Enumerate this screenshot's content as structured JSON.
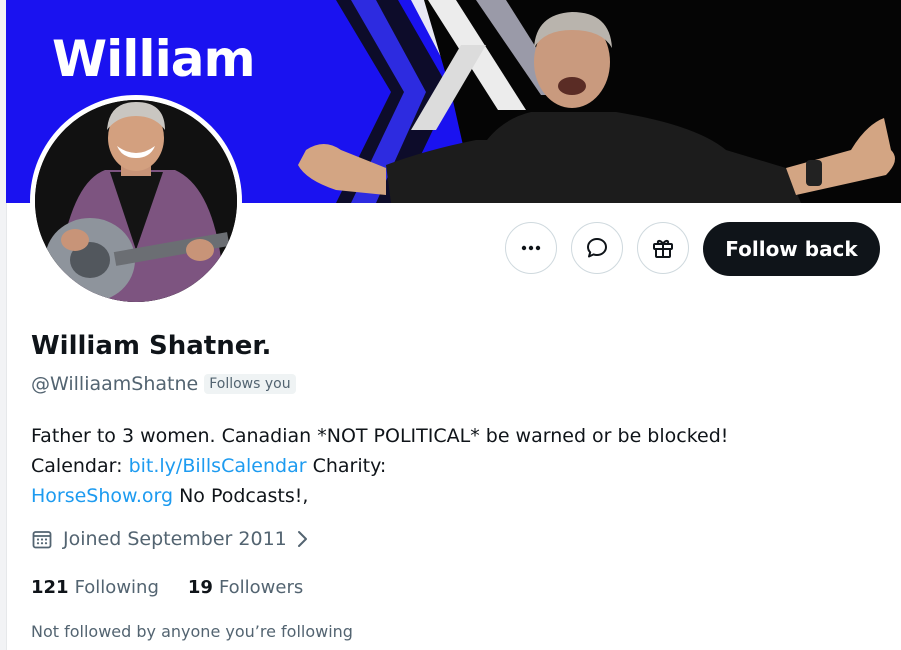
{
  "banner": {
    "word": "William",
    "bg_color": "#1a12f0"
  },
  "actions": {
    "more_icon": "more-horizontal-icon",
    "message_icon": "message-bubble-icon",
    "gift_icon": "gift-icon",
    "follow_label": "Follow back"
  },
  "profile": {
    "display_name": "William Shatner.",
    "handle": "@WilliaamShatne",
    "follows_you": "Follows you"
  },
  "bio": {
    "line1": "Father to 3 women. Canadian *NOT POLITICAL* be warned or be blocked!",
    "calendar_prefix": "Calendar:",
    "calendar_link": "bit.ly/BillsCalendar",
    "charity_label": "Charity:",
    "charity_link": "HorseShow.org",
    "tail": "No Podcasts!,"
  },
  "joined": {
    "icon": "calendar-icon",
    "text": "Joined September 2011",
    "chevron_icon": "chevron-right-icon"
  },
  "stats": {
    "following_count": "121",
    "following_label": "Following",
    "followers_count": "19",
    "followers_label": "Followers"
  },
  "mutuals_text": "Not followed by anyone you’re following",
  "colors": {
    "link": "#1d9bf0",
    "text_primary": "#0f1419",
    "text_secondary": "#536471",
    "follow_button": "#0f1419"
  }
}
